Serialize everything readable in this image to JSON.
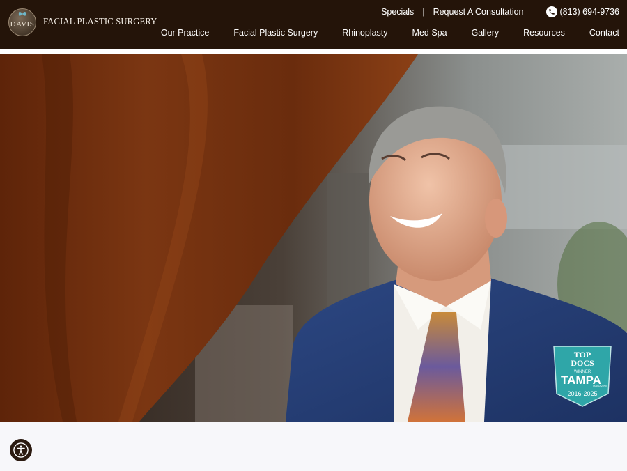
{
  "brand": {
    "emblem_text": "DAVIS",
    "name": "FACIAL PLASTIC SURGERY"
  },
  "utility": {
    "specials": "Specials",
    "separator": "|",
    "consultation": "Request A Consultation",
    "phone": "(813) 694-9736"
  },
  "nav": {
    "items": [
      "Our Practice",
      "Facial Plastic Surgery",
      "Rhinoplasty",
      "Med Spa",
      "Gallery",
      "Resources",
      "Contact"
    ]
  },
  "badge": {
    "line1": "TOP",
    "line2": "DOCS",
    "winner": "WINNER",
    "city": "TAMPA",
    "magazine": "MAGAZINE",
    "years": "2016-2025"
  },
  "colors": {
    "header_bg": "#241409",
    "badge_teal": "#2fa6a8",
    "curtain": "#7a3512",
    "suit": "#26407a"
  },
  "icons": {
    "phone": "phone-icon",
    "accessibility": "accessibility-icon"
  }
}
